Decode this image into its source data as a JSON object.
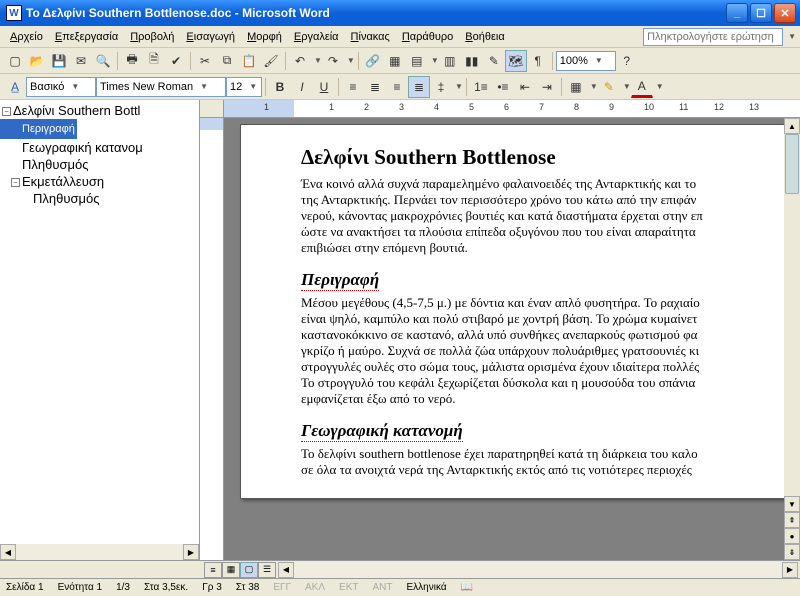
{
  "title": "Το Δελφίνι Southern Bottlenose.doc - Microsoft Word",
  "menu": [
    "Αρχείο",
    "Επεξεργασία",
    "Προβολή",
    "Εισαγωγή",
    "Μορφή",
    "Εργαλεία",
    "Πίνακας",
    "Παράθυρο",
    "Βοήθεια"
  ],
  "help_placeholder": "Πληκτρολογήστε ερώτηση",
  "zoom": "100%",
  "style": "Βασικό",
  "font": "Times New Roman",
  "size": "12",
  "outline": {
    "root": "Δελφίνι Southern Bottl",
    "items": [
      "Περιγραφή",
      "Γεωγραφική κατανομ",
      "Πληθυσμός"
    ],
    "root2": "Εκμετάλλευση",
    "items2": [
      "Πληθυσμός"
    ],
    "selected_index": 0
  },
  "doc": {
    "h1": "Δελφίνι Southern Bottlenose",
    "p1": "Ένα κοινό αλλά συχνά παραμελημένο φαλαινoειδές της Ανταρκτικής και το",
    "p2": "της Ανταρκτικής. Περνάει τον περισσότερο χρόνο του κάτω από την επιφάν",
    "p3": "νερού, κάνοντας μακροχρόνιες βουτιές και κατά διαστήματα έρχεται στην επ",
    "p4": "ώστε να ανακτήσει τα πλούσια επίπεδα οξυγόνου που του είναι απαραίτητα",
    "p5": "επιβιώσει στην επόμενη βουτιά.",
    "h2a": "Περιγραφή",
    "pa1": "Μέσου μεγέθους (4,5-7,5 μ.) με δόντια και έναν απλό φυσητήρα. Το ραχιαίο",
    "pa2": "είναι ψηλό, καμπύλο και πολύ στιβαρό με χοντρή βάση. Το χρώμα κυμαίνετ",
    "pa3": "καστανοκόκκινο σε καστανό, αλλά υπό συνθήκες ανεπαρκούς φωτισμού φα",
    "pa4": "γκρίζο ή μαύρο. Συχνά σε πολλά ζώα υπάρχουν πολυάριθμες γρατσουνιές κι",
    "pa5": "στρογγυλές ουλές στο σώμα τους, μάλιστα ορισμένα έχουν ιδιαίτερα πολλές",
    "pa6": "Το στρογγυλό του κεφάλι ξεχωρίζεται δύσκολα και η μουσούδα του σπάνια",
    "pa7": "εμφανίζεται έξω από το νερό.",
    "h2b": "Γεωγραφική κατανομή",
    "pb1": "Το δελφίνι southern bottlenose έχει παρατηρηθεί κατά τη διάρκεια του καλο",
    "pb2": "σε όλα τα ανοιχτά νερά της Ανταρκτικής εκτός από τις νοτιότερες περιοχές"
  },
  "status": {
    "page": "Σελίδα 1",
    "section": "Ενότητα 1",
    "pages": "1/3",
    "at": "Στα 3,5εκ.",
    "line": "Γρ 3",
    "col": "Στ 38",
    "rec": "ΕΓΓ",
    "trk": "ΑΚΛ",
    "ext": "ΕΚΤ",
    "ovr": "ΑΝΤ",
    "lang": "Ελληνικά"
  }
}
